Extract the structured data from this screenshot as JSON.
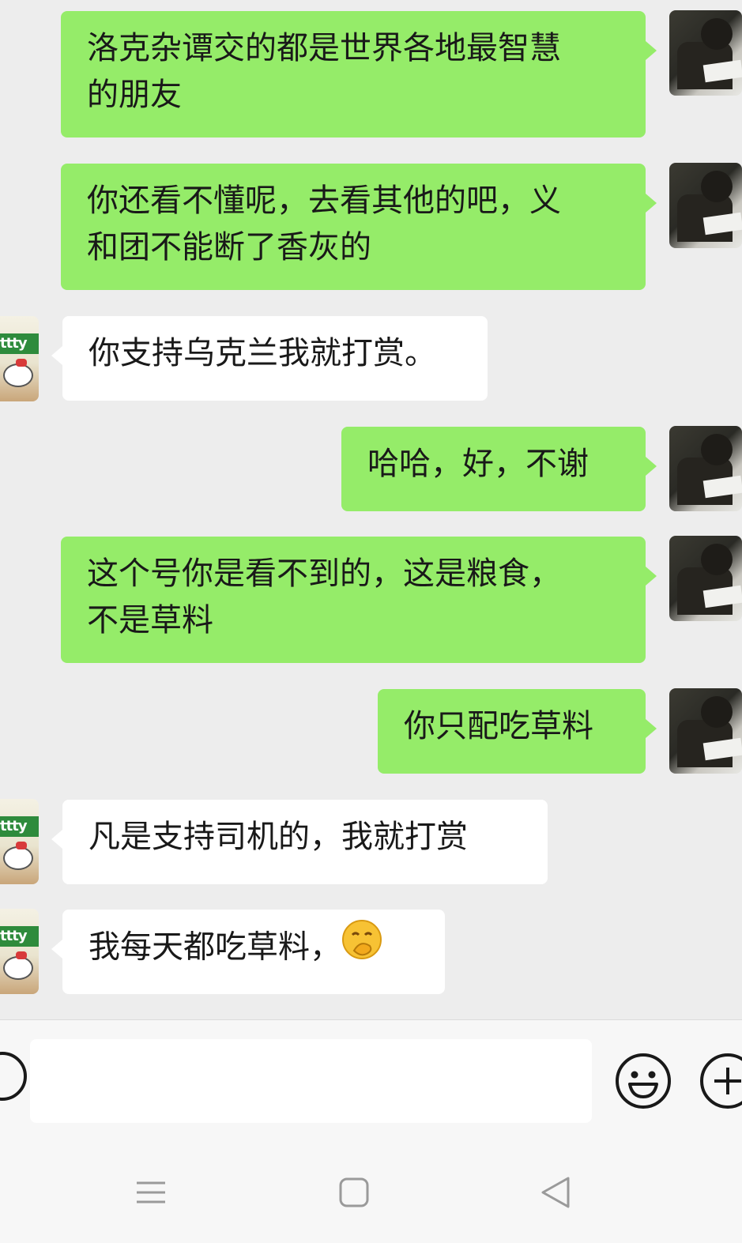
{
  "messages": [
    {
      "side": "sent",
      "text": "洛克杂谭交的都是世界各地最智慧\n的朋友"
    },
    {
      "side": "sent",
      "text": "你还看不懂呢，去看其他的吧，义\n和团不能断了香灰的"
    },
    {
      "side": "received",
      "text": "你支持乌克兰我就打赏。"
    },
    {
      "side": "sent",
      "text": "哈哈，好，不谢"
    },
    {
      "side": "sent",
      "text": "这个号你是看不到的，这是粮食，\n不是草料"
    },
    {
      "side": "sent",
      "text": "你只配吃草料"
    },
    {
      "side": "received",
      "text": "凡是支持司机的，我就打赏"
    },
    {
      "side": "received",
      "text": "我每天都吃草料，",
      "emoji": "hand-over-mouth-emoji"
    }
  ],
  "other_avatar_text": "ttty",
  "input": {
    "value": "",
    "placeholder": ""
  },
  "icons": {
    "voice": "voice-icon",
    "emoji": "smiley-icon",
    "plus": "plus-icon",
    "nav_menu": "menu-icon",
    "nav_home": "home-icon",
    "nav_back": "back-icon"
  },
  "colors": {
    "sent_bubble": "#95ec69",
    "received_bubble": "#ffffff",
    "background": "#ededed"
  }
}
